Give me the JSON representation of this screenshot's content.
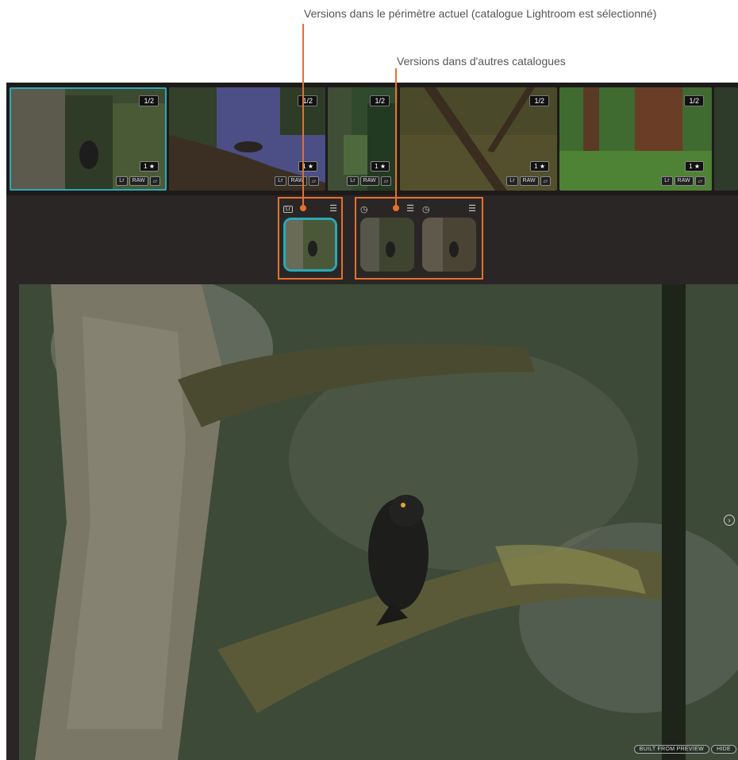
{
  "annotations": {
    "current_scope": "Versions dans le périmètre actuel (catalogue Lightroom est sélectionné)",
    "other_catalogs": "Versions dans d'autres catalogues"
  },
  "colors": {
    "accent_orange": "#e8702a",
    "selection_teal": "#2aa9b7"
  },
  "filmstrip": {
    "thumbs": [
      {
        "count": "1/2",
        "rating": "1 ★",
        "badges": [
          "Lr",
          "RAW",
          "stack"
        ],
        "selected": true
      },
      {
        "count": "1/2",
        "rating": "1 ★",
        "badges": [
          "Lr",
          "RAW",
          "stack"
        ],
        "selected": false
      },
      {
        "count": "1/2",
        "rating": "1 ★",
        "badges": [
          "Lr",
          "RAW",
          "stack"
        ],
        "selected": false
      },
      {
        "count": "1/2",
        "rating": "1 ★",
        "badges": [
          "Lr",
          "RAW",
          "stack"
        ],
        "selected": false
      },
      {
        "count": "1/2",
        "rating": "1 ★",
        "badges": [
          "Lr",
          "RAW",
          "stack"
        ],
        "selected": false
      }
    ]
  },
  "versions": {
    "current": {
      "source_badge": "Lr",
      "menu_icon": "menu-icon"
    },
    "others": [
      {
        "source_icon": "clock-icon",
        "menu_icon": "menu-icon"
      },
      {
        "source_icon": "clock-icon",
        "menu_icon": "menu-icon"
      }
    ]
  },
  "viewer": {
    "built_from_preview": "BUILT FROM PREVIEW",
    "hide": "HIDE",
    "next_icon": "chevron-right-circle-icon"
  }
}
